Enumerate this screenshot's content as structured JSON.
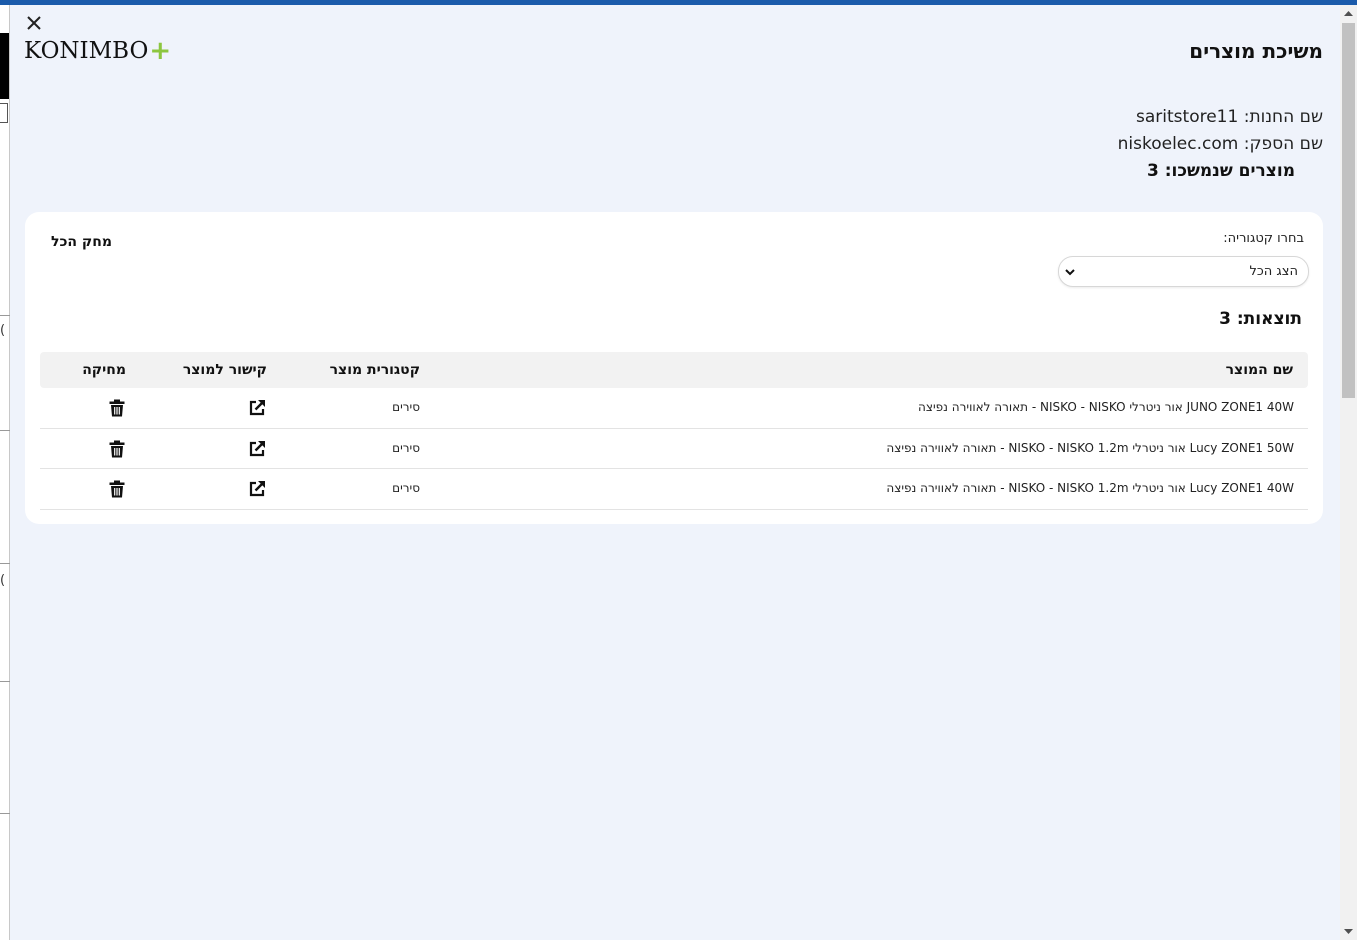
{
  "app": {
    "title": "משיכת מוצרים",
    "logo_text": "KONIMBO",
    "logo_plus": "+",
    "brand_color": "#8cc63f"
  },
  "info": {
    "store_line": "שם החנות: saritstore11",
    "supplier_line": "שם הספק: niskoelec.com",
    "pulled_line": "מוצרים שנמשכו: 3"
  },
  "filters": {
    "clear_all_label": "מחק הכל",
    "category_label": "בחרו קטגוריה:",
    "category_selected": "הצג הכל"
  },
  "results_label": "תוצאות: 3",
  "table": {
    "headers": {
      "name": "שם המוצר",
      "category": "קטגורית מוצר",
      "link": "קישור למוצר",
      "delete": "מחיקה"
    },
    "rows": [
      {
        "name": "JUNO ZONE1 40W אור ניטרלי NISKO - NISKO - תאורה לאווירה נפיצה",
        "category": "סירים",
        "link_icon": "external-link-icon",
        "delete_icon": "trash-icon"
      },
      {
        "name": "Lucy ZONE1 50W אור ניטרלי NISKO - NISKO 1.2m - תאורה לאווירה נפיצה",
        "category": "סירים",
        "link_icon": "external-link-icon",
        "delete_icon": "trash-icon"
      },
      {
        "name": "Lucy ZONE1 40W אור ניטרלי NISKO - NISKO 1.2m - תאורה לאווירה נפיצה",
        "category": "סירים",
        "link_icon": "external-link-icon",
        "delete_icon": "trash-icon"
      }
    ]
  },
  "icons": {
    "close": "close-icon",
    "dropdown": "chevron-down-icon"
  }
}
